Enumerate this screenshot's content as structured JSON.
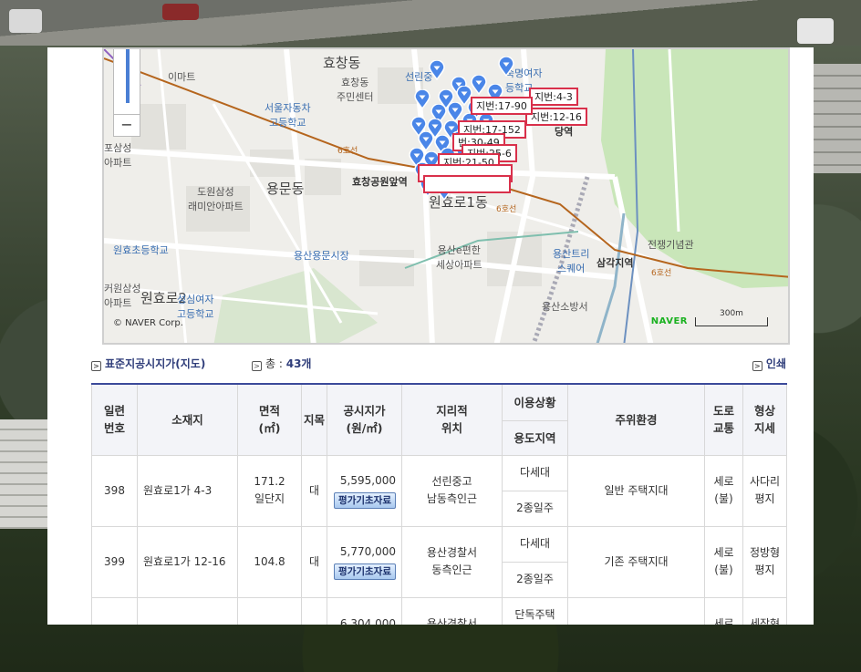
{
  "map": {
    "labels": {
      "hyochang_dong": "효창동",
      "emart": "이마트",
      "hyochang_center": "효창동\n주민센터",
      "seoul_auto": "서울자동차\n고등학교",
      "seonlin": "선린중",
      "sookmyung": "숙명여자\n등학교",
      "pohang": "포삼성\n아파트",
      "dowon": "도원삼성\n래미안아파트",
      "yongmun": "용문동",
      "hyochang_station": "효창공원앞역",
      "wonhyo_1dong": "원효로1동",
      "line6a": "6호선",
      "line6b": "6호선",
      "line6c": "6호선",
      "wonhyo_school": "원효초등학교",
      "yongsan_market": "용산용문시장",
      "yongsan_e": "용산e편한\n세상아파트",
      "samsung_lee": "커원삼성\n아파트",
      "wonhyo_2": "원효로2",
      "seongsim": "성심여자\n고등학교",
      "yongsan_tree": "용산트리\n스퀘어",
      "samgakji": "삼각지역",
      "war_memorial": "전쟁기념관",
      "fire": "용산소방서",
      "geomdang": "당역"
    },
    "jibun_labels": [
      "지번:4-3",
      "지번:17-90",
      "지번:12-16",
      "지번:17-152",
      "번:30-49",
      "지번:25-6",
      "지번:21-50"
    ],
    "copyright": "© NAVER Corp.",
    "naver_logo": "NAVER",
    "scale_label": "300m",
    "zoom_out": "−"
  },
  "subheader": {
    "title": "표준지공시지가(지도)",
    "total_prefix": "총 : ",
    "total_value": "43개",
    "print": "인쇄"
  },
  "table": {
    "headers": {
      "serial": "일련\n번호",
      "location": "소재지",
      "area": "면적\n(㎡)",
      "jimok": "지목",
      "price": "공시지가\n(원/㎡)",
      "geo": "지리적\n위치",
      "usage_top": "이용상황",
      "usage_bottom": "용도지역",
      "surround": "주위환경",
      "road": "도로\n교통",
      "shape": "형상\n지세"
    },
    "rows": [
      {
        "serial": "398",
        "location": "원효로1가 4-3",
        "area": "171.2\n일단지",
        "jimok": "대",
        "price": "5,595,000",
        "button": "평가기초자료",
        "geo": "선린중고\n남동측인근",
        "usage_top": "다세대",
        "usage_bottom": "2종일주",
        "surround": "일반 주택지대",
        "road": "세로\n(불)",
        "shape": "사다리\n평지"
      },
      {
        "serial": "399",
        "location": "원효로1가 12-16",
        "area": "104.8",
        "jimok": "대",
        "price": "5,770,000",
        "button": "평가기초자료",
        "geo": "용산경찰서\n동측인근",
        "usage_top": "다세대",
        "usage_bottom": "2종일주",
        "surround": "기존 주택지대",
        "road": "세로\n(불)",
        "shape": "정방형\n평지"
      },
      {
        "serial": "",
        "location": "",
        "area": "",
        "jimok": "",
        "price": "6,304,000",
        "button": "",
        "geo": "용산경찰서",
        "usage_top": "단독주택",
        "usage_bottom": "",
        "surround": "",
        "road": "세로",
        "shape": "세장형"
      }
    ]
  },
  "colors": {
    "accent": "#3b4a9a",
    "pin": "#4a86e8",
    "jibun_border": "#d9304b",
    "line6": "#b5651d"
  }
}
